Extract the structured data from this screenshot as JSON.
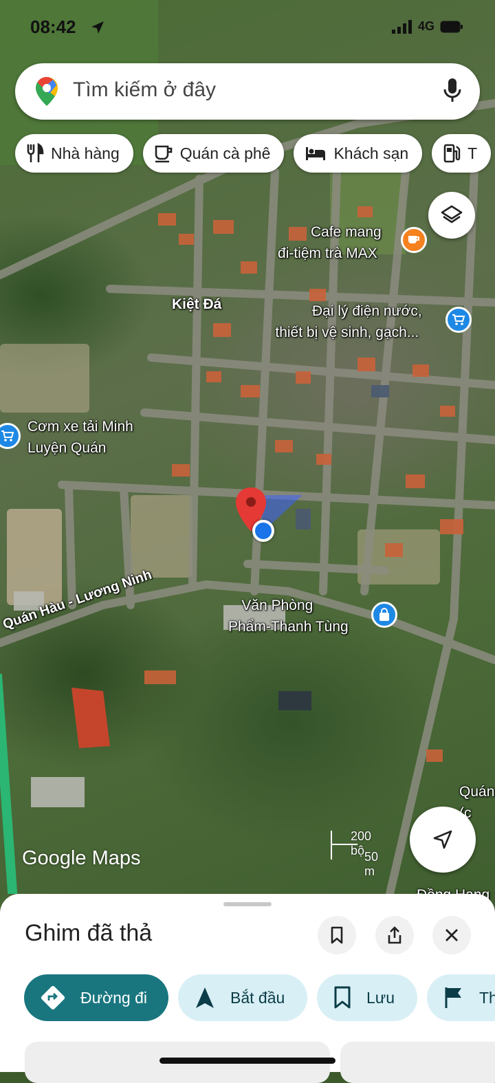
{
  "status_bar": {
    "time": "08:42",
    "network": "4G"
  },
  "search": {
    "placeholder": "Tìm kiếm ở đây"
  },
  "chips": [
    {
      "icon": "restaurant-icon",
      "label": "Nhà hàng"
    },
    {
      "icon": "coffee-icon",
      "label": "Quán cà phê"
    },
    {
      "icon": "hotel-icon",
      "label": "Khách sạn"
    },
    {
      "icon": "gas-station-icon",
      "label": "T"
    }
  ],
  "map": {
    "places": {
      "cafe": [
        "Cafe mang",
        "đi-tiệm trà MAX"
      ],
      "dai_ly": [
        "Đại lý điện nước,",
        "thiết bị vệ sinh, gạch..."
      ],
      "com_xe": [
        "Cơm xe tải Minh",
        "Luyện Quán"
      ],
      "van_phong": [
        "Văn Phòng",
        "Phẩm-Thanh Tùng"
      ],
      "quan_cut": [
        "Quán",
        "(c"
      ],
      "dong_cut": "Đồng Hang"
    },
    "areas": {
      "kiet_da": "Kiệt Đá"
    },
    "roads": {
      "quan_hau": "Quán Hàu - Lương Ninh"
    },
    "brand": "Google Maps",
    "scale": {
      "imperial": "200 bộ",
      "metric": "50 m"
    },
    "colors": {
      "pin": "#e53935",
      "location_dot": "#1a73e8",
      "poi_blue": "#1e88e5",
      "poi_orange": "#f5811f"
    }
  },
  "sheet": {
    "title": "Ghim đã thả",
    "actions": [
      {
        "icon": "directions-icon",
        "label": "Đường đi"
      },
      {
        "icon": "navigation-arrow-icon",
        "label": "Bắt đầu"
      },
      {
        "icon": "bookmark-icon",
        "label": "Lưu"
      },
      {
        "icon": "flag-icon",
        "label": "Th"
      }
    ]
  }
}
